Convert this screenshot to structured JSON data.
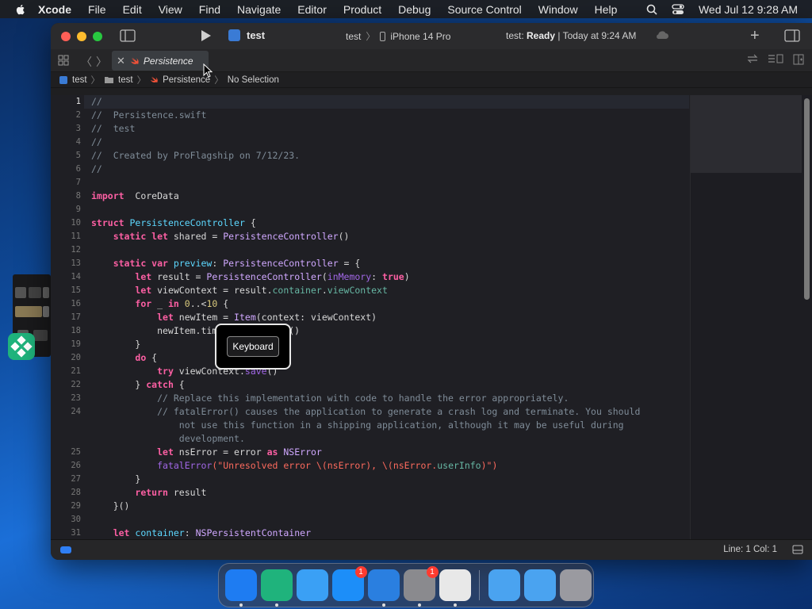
{
  "menubar": {
    "app_name": "Xcode",
    "items": [
      "File",
      "Edit",
      "View",
      "Find",
      "Navigate",
      "Editor",
      "Product",
      "Debug",
      "Source Control",
      "Window",
      "Help"
    ],
    "clock": "Wed Jul 12  9:28 AM"
  },
  "toolbar": {
    "scheme": "test",
    "destination_target": "test",
    "destination_device": "iPhone 14 Pro",
    "status_prefix": "test: ",
    "status_state": "Ready",
    "status_suffix": " | Today at 9:24 AM"
  },
  "tab": {
    "label": "Persistence"
  },
  "jumpbar": {
    "project": "test",
    "folder": "test",
    "file": "Persistence",
    "symbol": "No Selection"
  },
  "popover": {
    "label": "Keyboard"
  },
  "statusbar": {
    "position": "Line: 1  Col: 1"
  },
  "code": {
    "line_numbers": [
      "1",
      "2",
      "3",
      "4",
      "5",
      "6",
      "7",
      "8",
      "9",
      "10",
      "11",
      "12",
      "13",
      "14",
      "15",
      "16",
      "17",
      "18",
      "19",
      "20",
      "21",
      "22",
      "23",
      "24",
      "",
      "",
      "25",
      "26",
      "27",
      "28",
      "29",
      "30",
      "31"
    ],
    "active_line": "1",
    "lines": [
      [
        [
          "cm",
          "//"
        ]
      ],
      [
        [
          "cm",
          "//  Persistence.swift"
        ]
      ],
      [
        [
          "cm",
          "//  test"
        ]
      ],
      [
        [
          "cm",
          "//"
        ]
      ],
      [
        [
          "cm",
          "//  Created by ProFlagship on 7/12/23."
        ]
      ],
      [
        [
          "cm",
          "//"
        ]
      ],
      [],
      [
        [
          "kw",
          "import"
        ],
        [
          "",
          "  CoreData"
        ]
      ],
      [],
      [
        [
          "kw",
          "struct"
        ],
        [
          "",
          " "
        ],
        [
          "cls",
          "PersistenceController"
        ],
        [
          "",
          " {"
        ]
      ],
      [
        [
          "",
          "    "
        ],
        [
          "kw",
          "static let"
        ],
        [
          "",
          " shared = "
        ],
        [
          "ty",
          "PersistenceController"
        ],
        [
          "",
          "()"
        ]
      ],
      [],
      [
        [
          "",
          "    "
        ],
        [
          "kw",
          "static var"
        ],
        [
          "",
          " "
        ],
        [
          "decl",
          "preview"
        ],
        [
          "",
          ": "
        ],
        [
          "ty",
          "PersistenceController"
        ],
        [
          "",
          " = {"
        ]
      ],
      [
        [
          "",
          "        "
        ],
        [
          "kw",
          "let"
        ],
        [
          "",
          " result = "
        ],
        [
          "ty",
          "PersistenceController"
        ],
        [
          "",
          "("
        ],
        [
          "fn",
          "inMemory"
        ],
        [
          "",
          ": "
        ],
        [
          "kw",
          "true"
        ],
        [
          "",
          ")"
        ]
      ],
      [
        [
          "",
          "        "
        ],
        [
          "kw",
          "let"
        ],
        [
          "",
          " viewContext = result."
        ],
        [
          "prop",
          "container"
        ],
        [
          "",
          "."
        ],
        [
          "prop",
          "viewContext"
        ]
      ],
      [
        [
          "",
          "        "
        ],
        [
          "kw",
          "for"
        ],
        [
          "",
          " _ "
        ],
        [
          "kw",
          "in"
        ],
        [
          "",
          " "
        ],
        [
          "num",
          "0"
        ],
        [
          "",
          "..<"
        ],
        [
          "num",
          "10"
        ],
        [
          "",
          " {"
        ]
      ],
      [
        [
          "",
          "            "
        ],
        [
          "kw",
          "let"
        ],
        [
          "",
          " newItem = "
        ],
        [
          "ty",
          "Item"
        ],
        [
          "",
          "(context: viewContext)"
        ]
      ],
      [
        [
          "",
          "            newItem.timestamp = Date()"
        ]
      ],
      [
        [
          "",
          "        }"
        ]
      ],
      [
        [
          "",
          "        "
        ],
        [
          "kw",
          "do"
        ],
        [
          "",
          " {"
        ]
      ],
      [
        [
          "",
          "            "
        ],
        [
          "kw",
          "try"
        ],
        [
          "",
          " viewContext."
        ],
        [
          "fn",
          "save"
        ],
        [
          "",
          "()"
        ]
      ],
      [
        [
          "",
          "        } "
        ],
        [
          "kw",
          "catch"
        ],
        [
          "",
          " {"
        ]
      ],
      [
        [
          "",
          "            "
        ],
        [
          "cm",
          "// Replace this implementation with code to handle the error appropriately."
        ]
      ],
      [
        [
          "",
          "            "
        ],
        [
          "cm",
          "// fatalError() causes the application to generate a crash log and terminate. You should"
        ]
      ],
      [
        [
          "",
          "                "
        ],
        [
          "cm",
          "not use this function in a shipping application, although it may be useful during"
        ]
      ],
      [
        [
          "",
          "                "
        ],
        [
          "cm",
          "development."
        ]
      ],
      [
        [
          "",
          "            "
        ],
        [
          "kw",
          "let"
        ],
        [
          "",
          " nsError = error "
        ],
        [
          "kw",
          "as"
        ],
        [
          "",
          " "
        ],
        [
          "ty",
          "NSError"
        ]
      ],
      [
        [
          "",
          "            "
        ],
        [
          "fn",
          "fatalError"
        ],
        [
          "str",
          "(\"Unresolved error \\(nsError), \\(nsError."
        ],
        [
          "prop",
          "userInfo"
        ],
        [
          "str",
          ")\")"
        ]
      ],
      [
        [
          "",
          "        }"
        ]
      ],
      [
        [
          "",
          "        "
        ],
        [
          "kw",
          "return"
        ],
        [
          "",
          " result"
        ]
      ],
      [
        [
          "",
          "    }()"
        ]
      ],
      [],
      [
        [
          "",
          "    "
        ],
        [
          "kw",
          "let"
        ],
        [
          "",
          " "
        ],
        [
          "decl",
          "container"
        ],
        [
          "",
          ": "
        ],
        [
          "ty",
          "NSPersistentContainer"
        ]
      ]
    ]
  },
  "dock": {
    "apps": [
      {
        "name": "finder",
        "color": "#1e7cf2",
        "badge": ""
      },
      {
        "name": "app-green",
        "color": "#1fb37c",
        "badge": ""
      },
      {
        "name": "mail",
        "color": "#3aa0f5",
        "badge": ""
      },
      {
        "name": "app-store",
        "color": "#1c8ef9",
        "badge": "1"
      },
      {
        "name": "xcode",
        "color": "#2a7fe0",
        "badge": ""
      },
      {
        "name": "system-settings",
        "color": "#8a8a8e",
        "badge": "1"
      },
      {
        "name": "chrome",
        "color": "#e8e8e8",
        "badge": ""
      },
      {
        "name": "folder",
        "color": "#4aa3f0",
        "badge": ""
      },
      {
        "name": "downloads",
        "color": "#4aa3f0",
        "badge": ""
      },
      {
        "name": "trash",
        "color": "#9a9aa0",
        "badge": ""
      }
    ]
  }
}
